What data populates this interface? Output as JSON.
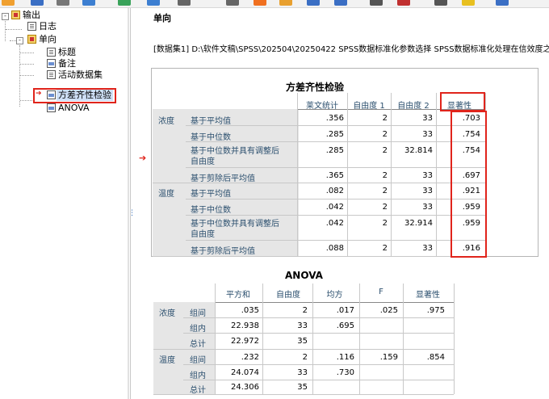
{
  "navigator": {
    "items": [
      {
        "label": "输出",
        "level": 0
      },
      {
        "label": "日志",
        "level": 1
      },
      {
        "label": "单向",
        "level": 1
      },
      {
        "label": "标题",
        "level": 2
      },
      {
        "label": "备注",
        "level": 2
      },
      {
        "label": "活动数据集",
        "level": 2
      },
      {
        "label": "方差齐性检验",
        "level": 2,
        "selected": true
      },
      {
        "label": "ANOVA",
        "level": 2
      }
    ],
    "toggle_expanded": "-",
    "toggle_collapsed": "+"
  },
  "content": {
    "heading": "单向",
    "dataset_line": "[数据集1] D:\\软件文稿\\SPSS\\202504\\20250422 SPSS数据标准化参数选择 SPSS数据标准化处理在信效度之",
    "arrow": "➔"
  },
  "levene_table": {
    "title": "方差齐性检验",
    "columns": [
      "莱文统计",
      "自由度 1",
      "自由度 2",
      "显著性"
    ],
    "groups": [
      {
        "name": "浓度",
        "rows": [
          {
            "label": "基于平均值",
            "values": [
              ".356",
              "2",
              "33",
              ".703"
            ]
          },
          {
            "label": "基于中位数",
            "values": [
              ".285",
              "2",
              "33",
              ".754"
            ]
          },
          {
            "label": "基于中位数并具有调整后自由度",
            "label_lines": [
              "基于中位数并具有调整后",
              "自由度"
            ],
            "values": [
              ".285",
              "2",
              "32.814",
              ".754"
            ]
          },
          {
            "label": "基于剪除后平均值",
            "values": [
              ".365",
              "2",
              "33",
              ".697"
            ]
          }
        ]
      },
      {
        "name": "温度",
        "rows": [
          {
            "label": "基于平均值",
            "values": [
              ".082",
              "2",
              "33",
              ".921"
            ]
          },
          {
            "label": "基于中位数",
            "values": [
              ".042",
              "2",
              "33",
              ".959"
            ]
          },
          {
            "label": "基于中位数并具有调整后自由度",
            "label_lines": [
              "基于中位数并具有调整后",
              "自由度"
            ],
            "values": [
              ".042",
              "2",
              "32.914",
              ".959"
            ]
          },
          {
            "label": "基于剪除后平均值",
            "values": [
              ".088",
              "2",
              "33",
              ".916"
            ]
          }
        ]
      }
    ]
  },
  "anova_table": {
    "title": "ANOVA",
    "columns": [
      "平方和",
      "自由度",
      "均方",
      "F",
      "显著性"
    ],
    "groups": [
      {
        "name": "浓度",
        "rows": [
          {
            "label": "组间",
            "values": [
              ".035",
              "2",
              ".017",
              ".025",
              ".975"
            ]
          },
          {
            "label": "组内",
            "values": [
              "22.938",
              "33",
              ".695",
              "",
              ""
            ]
          },
          {
            "label": "总计",
            "values": [
              "22.972",
              "35",
              "",
              "",
              ""
            ]
          }
        ]
      },
      {
        "name": "温度",
        "rows": [
          {
            "label": "组间",
            "values": [
              ".232",
              "2",
              ".116",
              ".159",
              ".854"
            ]
          },
          {
            "label": "组内",
            "values": [
              "24.074",
              "33",
              ".730",
              "",
              ""
            ]
          },
          {
            "label": "总计",
            "values": [
              "24.306",
              "35",
              "",
              "",
              ""
            ]
          }
        ]
      }
    ]
  },
  "colors": {
    "highlight": "#e0241b",
    "selection": "#cfe0f7",
    "header_text": "#2b4f6e",
    "shade": "#e6e6e6"
  }
}
